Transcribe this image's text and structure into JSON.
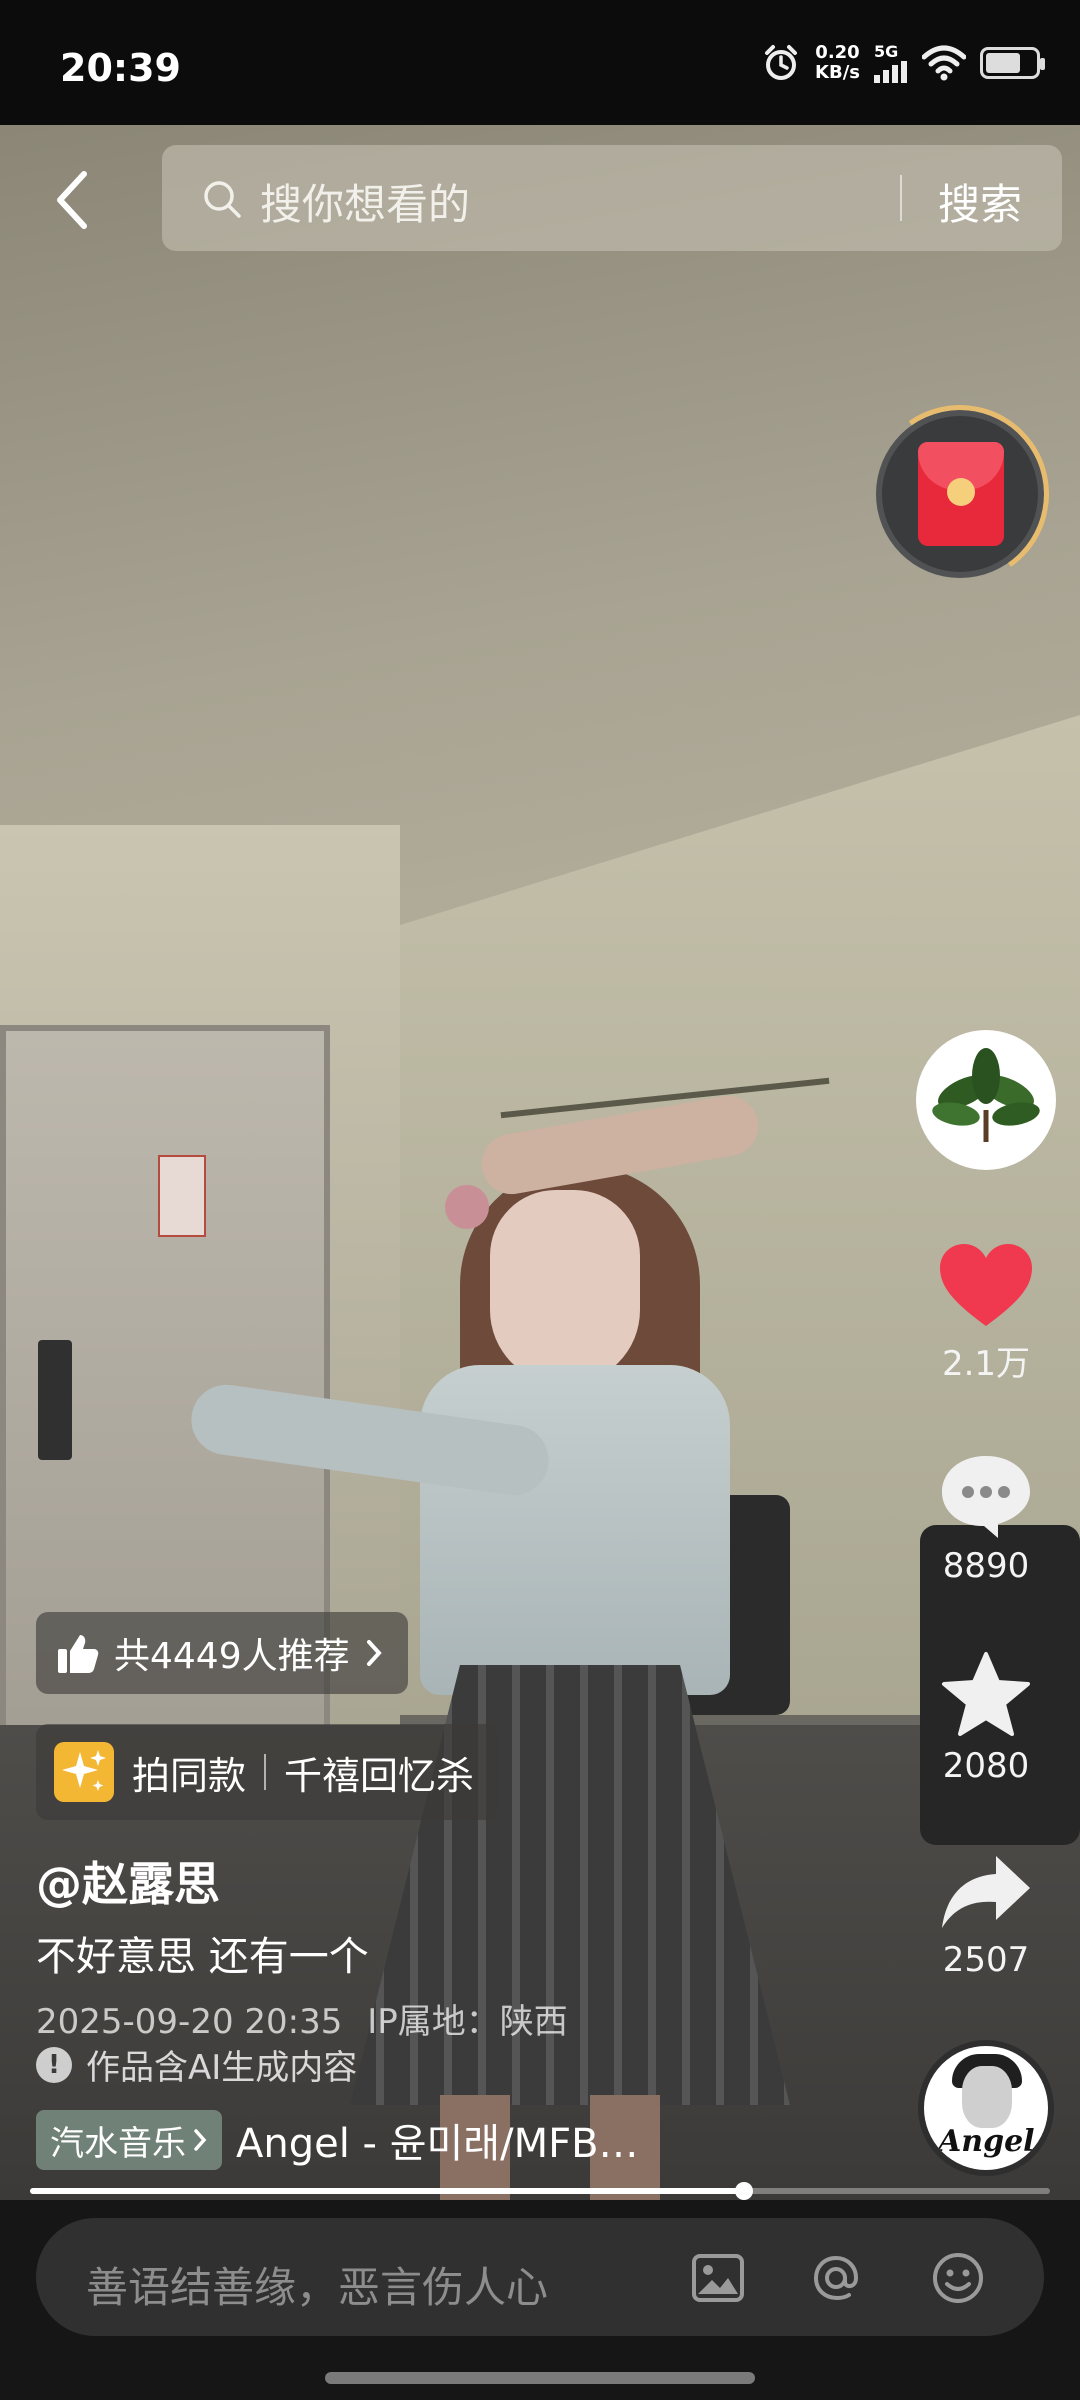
{
  "status_bar": {
    "time": "20:39",
    "net_speed_value": "0.20",
    "net_speed_unit": "KB/s",
    "network": "5G",
    "battery_level": 0.7
  },
  "search": {
    "placeholder": "搜你想看的",
    "button_label": "搜索"
  },
  "actions": {
    "likes": "2.1万",
    "comments": "8890",
    "favorites": "2080",
    "shares": "2507"
  },
  "recommend": {
    "text": "共4449人推荐"
  },
  "same_style": {
    "label": "拍同款",
    "song": "千禧回忆杀"
  },
  "post": {
    "author": "@赵露思",
    "caption": "不好意思 还有一个",
    "datetime": "2025-09-20 20:35",
    "ip_location": "IP属地：陕西",
    "ai_notice": "作品含AI生成内容"
  },
  "music": {
    "tag": "汽水音乐",
    "title": "Angel - 윤미래/MFB…",
    "disc_text": "Angel"
  },
  "progress": {
    "played_fraction": 0.7
  },
  "comment_bar": {
    "placeholder": "善语结善缘，恶言伤人心"
  },
  "colors": {
    "like_red": "#f0394f",
    "red_packet": "#e8283b",
    "ring_gold": "#e8bc6e"
  },
  "icons": [
    "back-arrow-icon",
    "search-icon",
    "red-packet-icon",
    "heart-icon",
    "comment-icon",
    "star-icon",
    "share-icon",
    "thumbs-up-icon",
    "sparkle-icon",
    "image-icon",
    "at-icon",
    "emoji-icon"
  ]
}
